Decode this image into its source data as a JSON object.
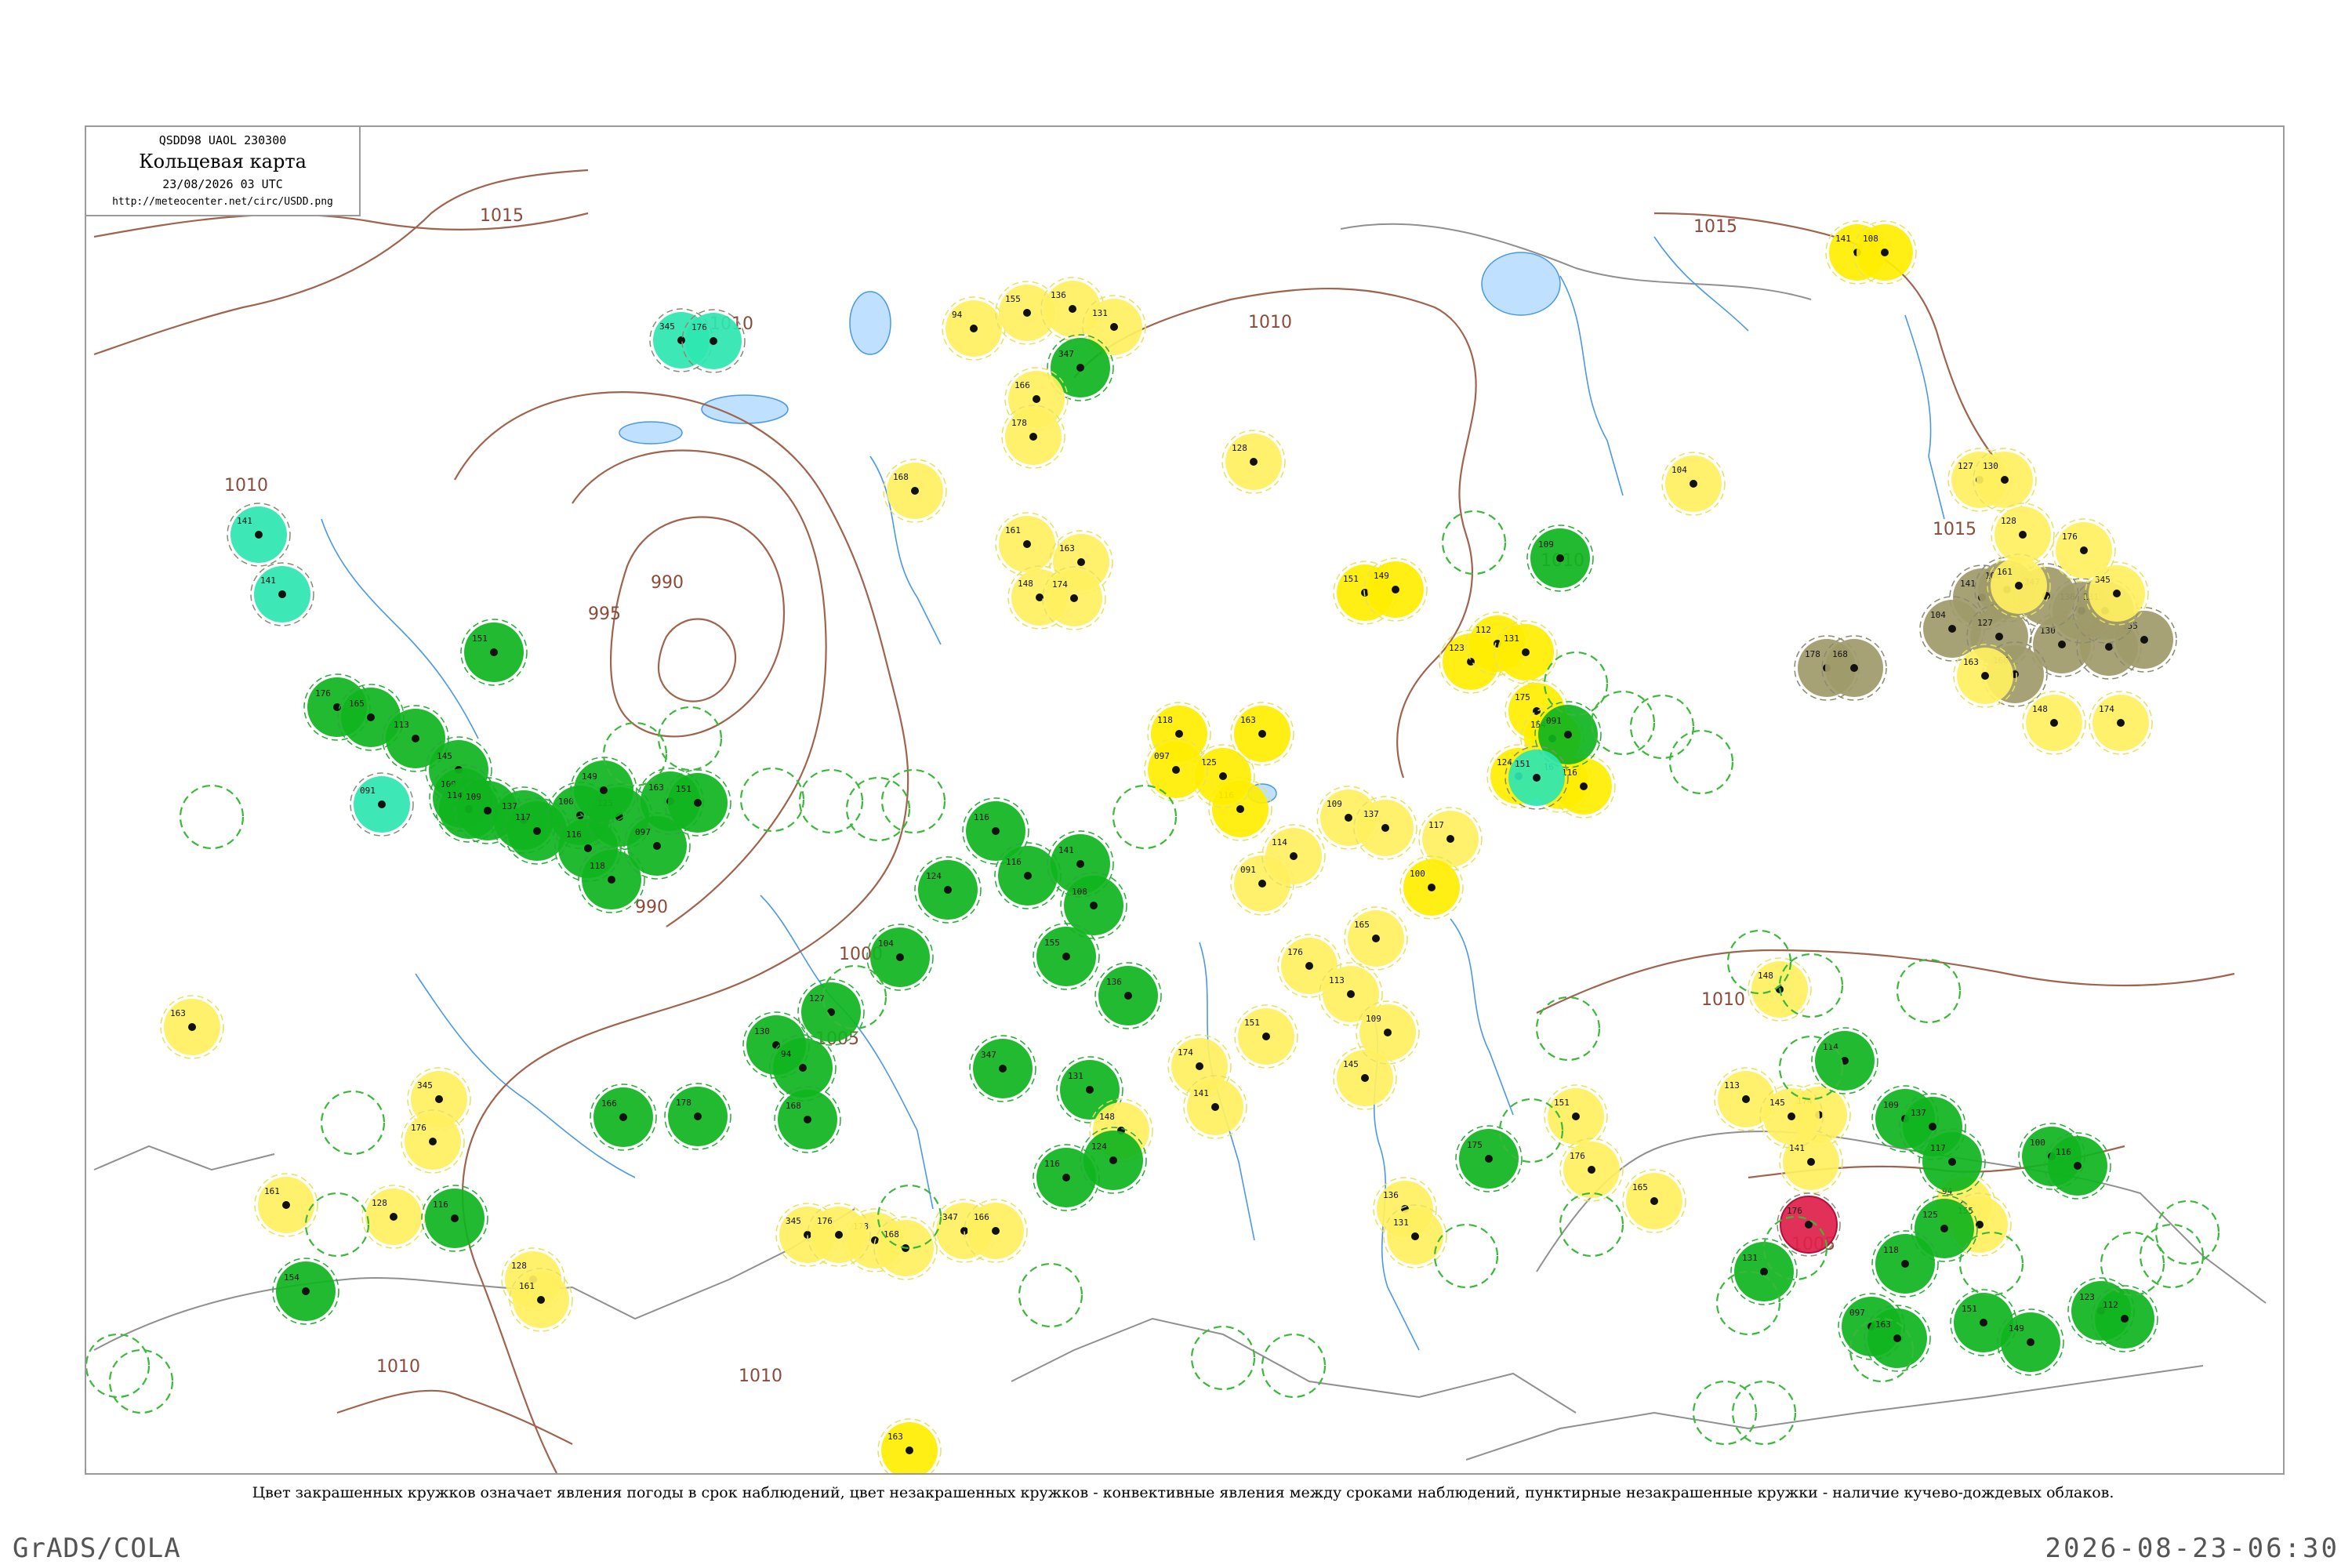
{
  "header": {
    "code": "QSDD98  UAOL  230300",
    "title": "Кольцевая карта",
    "date": "23/08/2026 03 UTC",
    "url": "http://meteocenter.net/circ/USDD.png"
  },
  "isobars": [
    {
      "label": "1015"
    },
    {
      "label": "1010"
    },
    {
      "label": "1005"
    },
    {
      "label": "1000"
    },
    {
      "label": "995"
    },
    {
      "label": "990"
    }
  ],
  "caption": "Цвет закрашенных кружков означает явления погоды в срок наблюдений, цвет незакрашенных кружков - конвективные явления между сроками наблюдений, пунктирные незакрашенные кружки - наличие кучево-дождевых облаков.",
  "footer": {
    "left": "GrADS/COLA",
    "right": "2026-08-23-06:30"
  },
  "colors": {
    "rain": "#0fb41e",
    "showers_light": "#33d25a",
    "fog": "#fff060",
    "haze": "#ffee00",
    "thunder_mint": "#2ee6b0",
    "dust": "#a09a6a",
    "storm_red": "#e0204a",
    "cb_dashed": "#3ab83a",
    "isobar": "#a0644e",
    "river": "#4a98e6",
    "border": "#909090"
  },
  "station_numbers": [
    "94",
    "155",
    "136",
    "131",
    "347",
    "166",
    "178",
    "168",
    "345",
    "176",
    "128",
    "161",
    "163",
    "148",
    "174",
    "141",
    "151",
    "176",
    "165",
    "113",
    "145",
    "109",
    "091",
    "114",
    "109",
    "137",
    "117",
    "100",
    "116",
    "125",
    "118",
    "097",
    "163",
    "151",
    "149",
    "123",
    "112",
    "131",
    "175",
    "154",
    "116",
    "116",
    "124",
    "141",
    "108",
    "104",
    "127",
    "130"
  ]
}
